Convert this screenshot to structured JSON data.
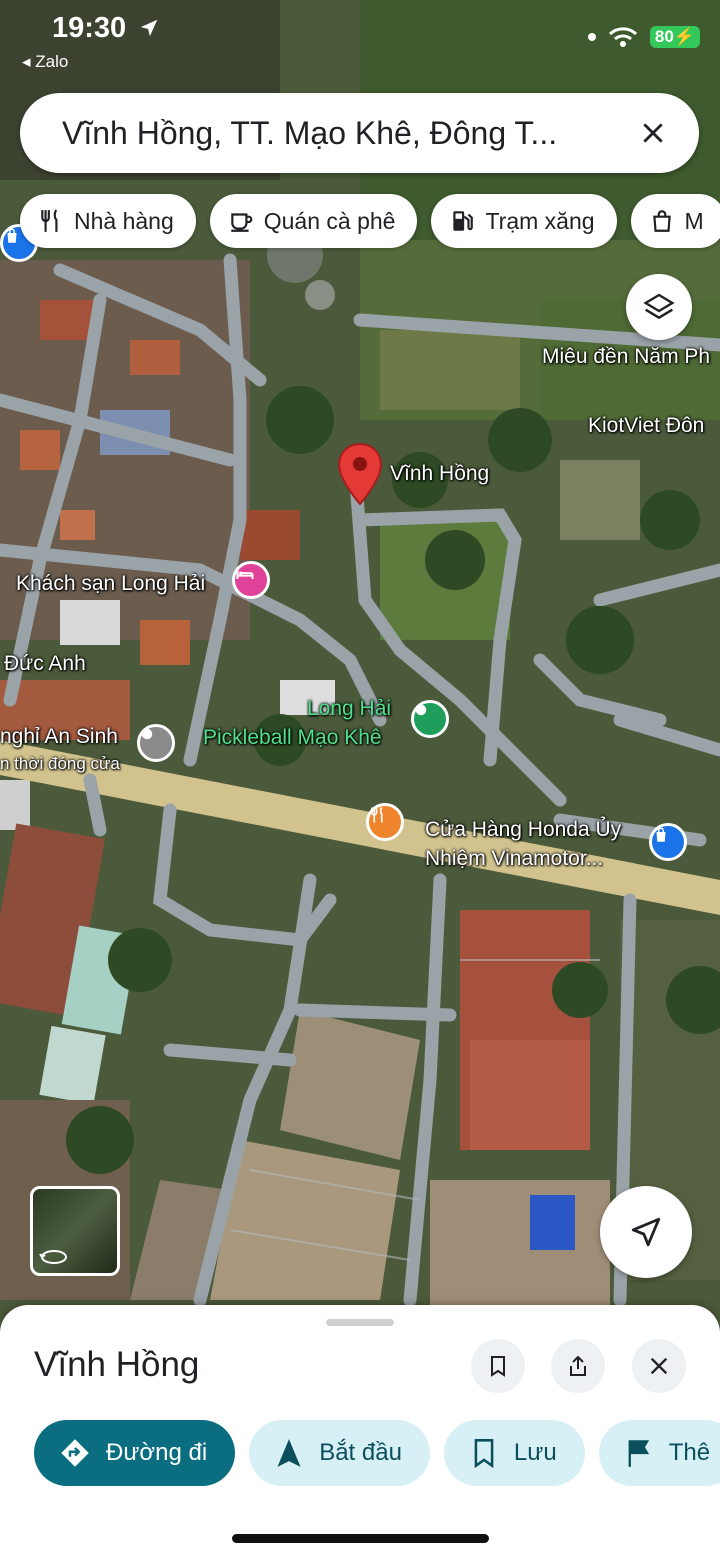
{
  "status_bar": {
    "time": "19:30",
    "back_app": "◂ Zalo",
    "battery": "80"
  },
  "search": {
    "text": "Vĩnh Hồng, TT. Mạo Khê, Đông T..."
  },
  "chips": [
    {
      "label": "Nhà hàng",
      "icon": "fork-knife-icon"
    },
    {
      "label": "Quán cà phê",
      "icon": "coffee-cup-icon"
    },
    {
      "label": "Trạm xăng",
      "icon": "gas-pump-icon"
    },
    {
      "label": "M",
      "icon": "shopping-bag-icon"
    }
  ],
  "map_labels": {
    "mieu_den": "Miêu đền Năm Ph",
    "kiotviet": "KiotViet Đôn",
    "vinh_hong": "Vĩnh Hồng",
    "khach_san": "Khách sạn Long Hải",
    "duc_anh": "Đức Anh",
    "long_hai": "Long Hải",
    "pickleball": "Pickleball Mạo Khê",
    "nghi_an_sinh": "nghỉ An Sinh",
    "tam_dong": "n thời đóng cửa",
    "honda_1": "Cửa Hàng Honda Ủy",
    "honda_2": "Nhiệm Vinamotor..."
  },
  "colors": {
    "pin_red": "#e53935",
    "hotel_pink": "#e0429a",
    "park_green": "#1e9e5a",
    "restaurant_orange": "#f0842c",
    "shop_blue": "#1a73e8",
    "primary_teal": "#0b6e80",
    "tonal_teal": "#d6f0f5"
  },
  "sheet": {
    "title": "Vĩnh Hồng",
    "actions": [
      {
        "label": "Đường đi",
        "icon": "directions-icon"
      },
      {
        "label": "Bắt đầu",
        "icon": "navigation-arrow-icon"
      },
      {
        "label": "Lưu",
        "icon": "bookmark-icon"
      },
      {
        "label": "Thê",
        "icon": "flag-icon"
      }
    ]
  }
}
